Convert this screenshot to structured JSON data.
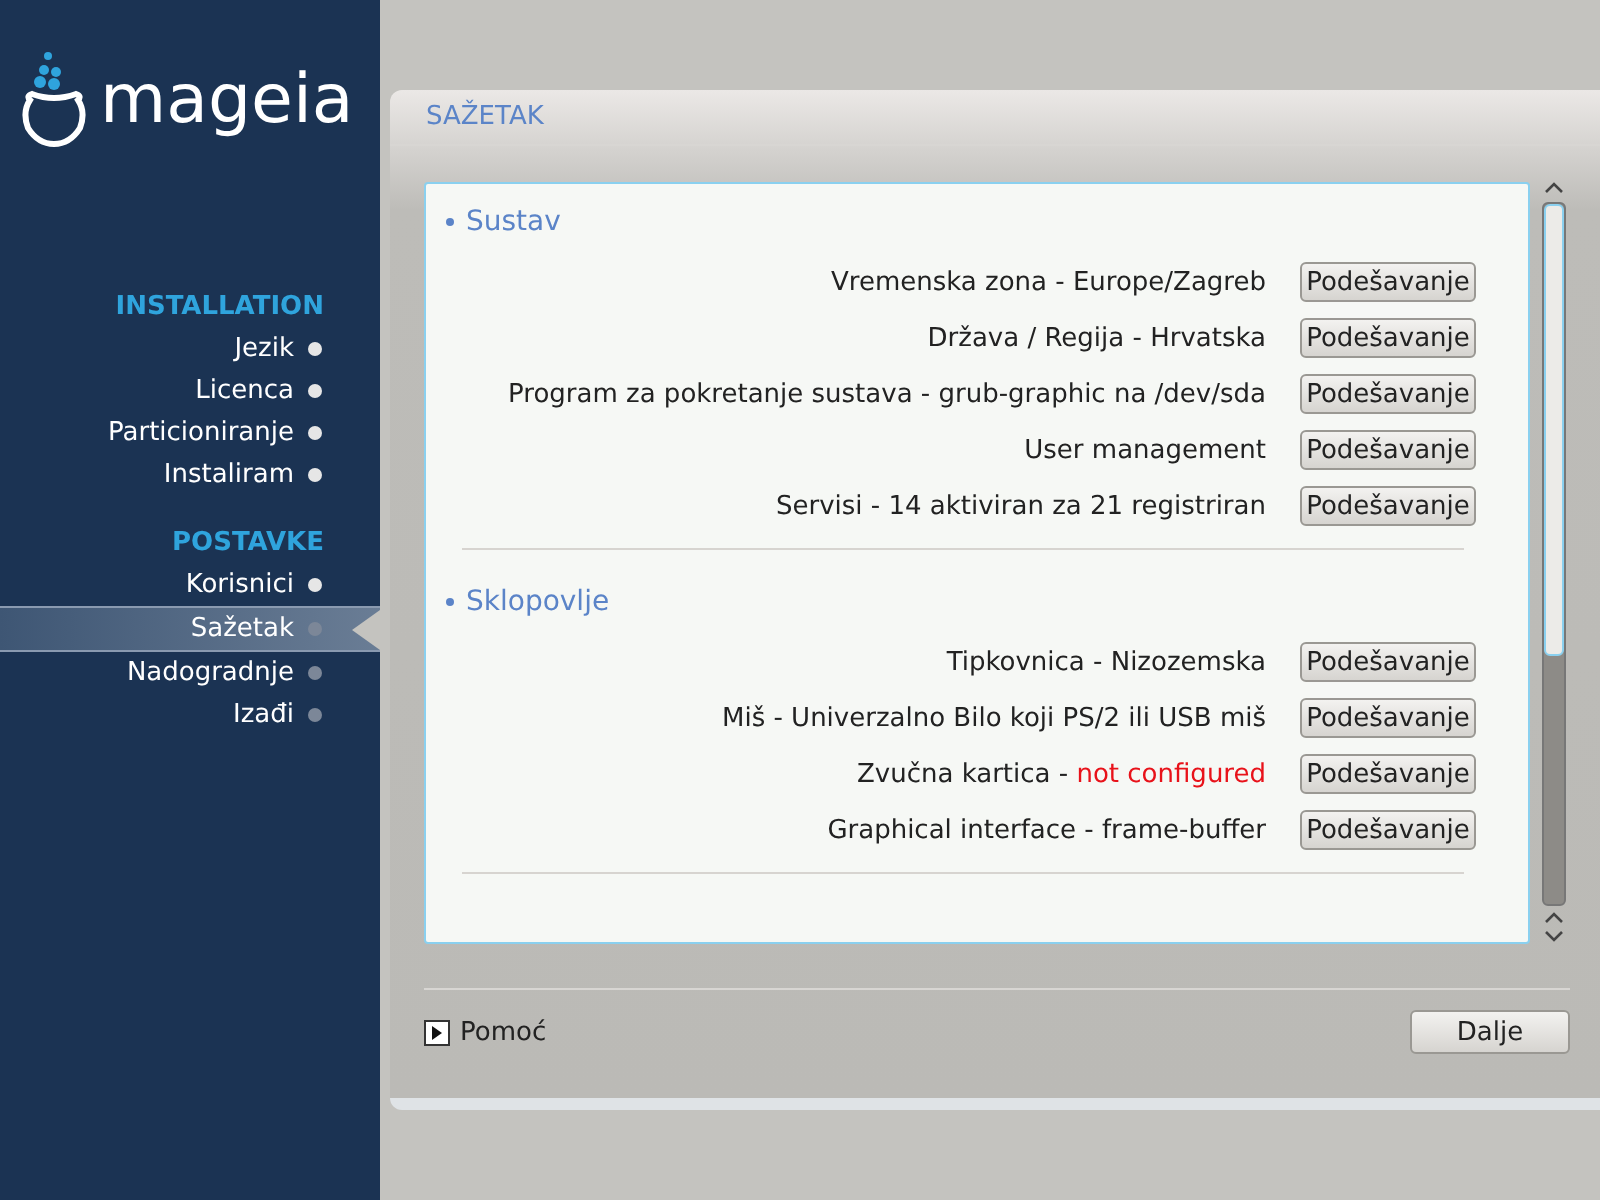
{
  "logo": {
    "text": "mageia"
  },
  "sidebar": {
    "sections": [
      {
        "title": "INSTALLATION",
        "items": [
          {
            "label": "Jezik",
            "done": true,
            "selected": false
          },
          {
            "label": "Licenca",
            "done": true,
            "selected": false
          },
          {
            "label": "Particioniranje",
            "done": true,
            "selected": false
          },
          {
            "label": "Instaliram",
            "done": true,
            "selected": false
          }
        ]
      },
      {
        "title": "POSTAVKE",
        "items": [
          {
            "label": "Korisnici",
            "done": true,
            "selected": false
          },
          {
            "label": "Sažetak",
            "done": false,
            "selected": true
          },
          {
            "label": "Nadogradnje",
            "done": false,
            "selected": false
          },
          {
            "label": "Izađi",
            "done": false,
            "selected": false
          }
        ]
      }
    ]
  },
  "page": {
    "title": "SAŽETAK",
    "groups": [
      {
        "title": "Sustav",
        "rows": [
          {
            "label": "Vremenska zona - Europe/Zagreb",
            "button": "Podešavanje"
          },
          {
            "label": "Država / Regija - Hrvatska",
            "button": "Podešavanje"
          },
          {
            "label": "Program za pokretanje sustava - grub-graphic na /dev/sda",
            "button": "Podešavanje"
          },
          {
            "label": "User management",
            "button": "Podešavanje"
          },
          {
            "label": "Servisi - 14 aktiviran za 21 registriran",
            "button": "Podešavanje"
          }
        ]
      },
      {
        "title": "Sklopovlje",
        "rows": [
          {
            "label": "Tipkovnica - Nizozemska",
            "button": "Podešavanje"
          },
          {
            "label": "Miš - Univerzalno Bilo koji PS/2 ili USB miš",
            "button": "Podešavanje"
          },
          {
            "label": "Zvučna kartica -",
            "value": "not configured",
            "warning": true,
            "button": "Podešavanje"
          },
          {
            "label": "Graphical interface - frame-buffer",
            "button": "Podešavanje"
          }
        ]
      }
    ]
  },
  "footer": {
    "help": "Pomoć",
    "next": "Dalje"
  }
}
